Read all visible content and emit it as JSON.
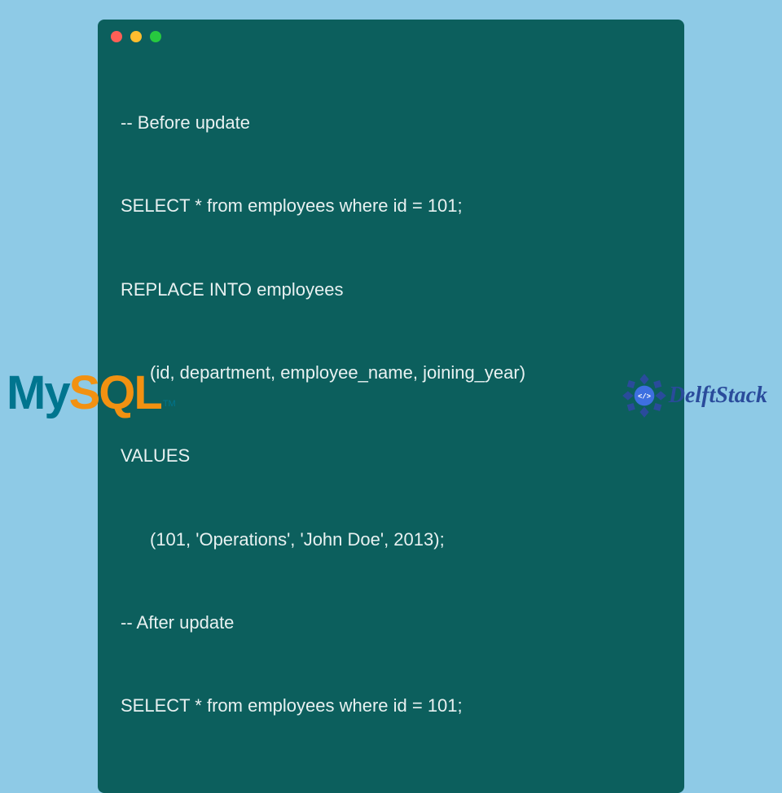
{
  "code": {
    "lines": [
      {
        "text": "-- Before update",
        "indent": false
      },
      {
        "text": "SELECT * from employees where id = 101;",
        "indent": false
      },
      {
        "text": "REPLACE INTO employees",
        "indent": false
      },
      {
        "text": "(id, department, employee_name, joining_year)",
        "indent": true
      },
      {
        "text": "VALUES",
        "indent": false
      },
      {
        "text": "(101, 'Operations', 'John Doe', 2013);",
        "indent": true
      },
      {
        "text": "-- After update",
        "indent": false
      },
      {
        "text": "SELECT * from employees where id = 101;",
        "indent": false
      }
    ]
  },
  "logos": {
    "mysql": {
      "my": "My",
      "sql": "SQL",
      "tm": "TM"
    },
    "delftstack": {
      "text": "DelftStack",
      "emblem_core": "</>"
    }
  },
  "colors": {
    "page_bg": "#8ecae6",
    "window_bg": "#0c5f5d",
    "code_text": "#e8f1f1",
    "mysql_blue": "#00758f",
    "mysql_orange": "#f29111",
    "delft_blue": "#2a4b9b"
  }
}
